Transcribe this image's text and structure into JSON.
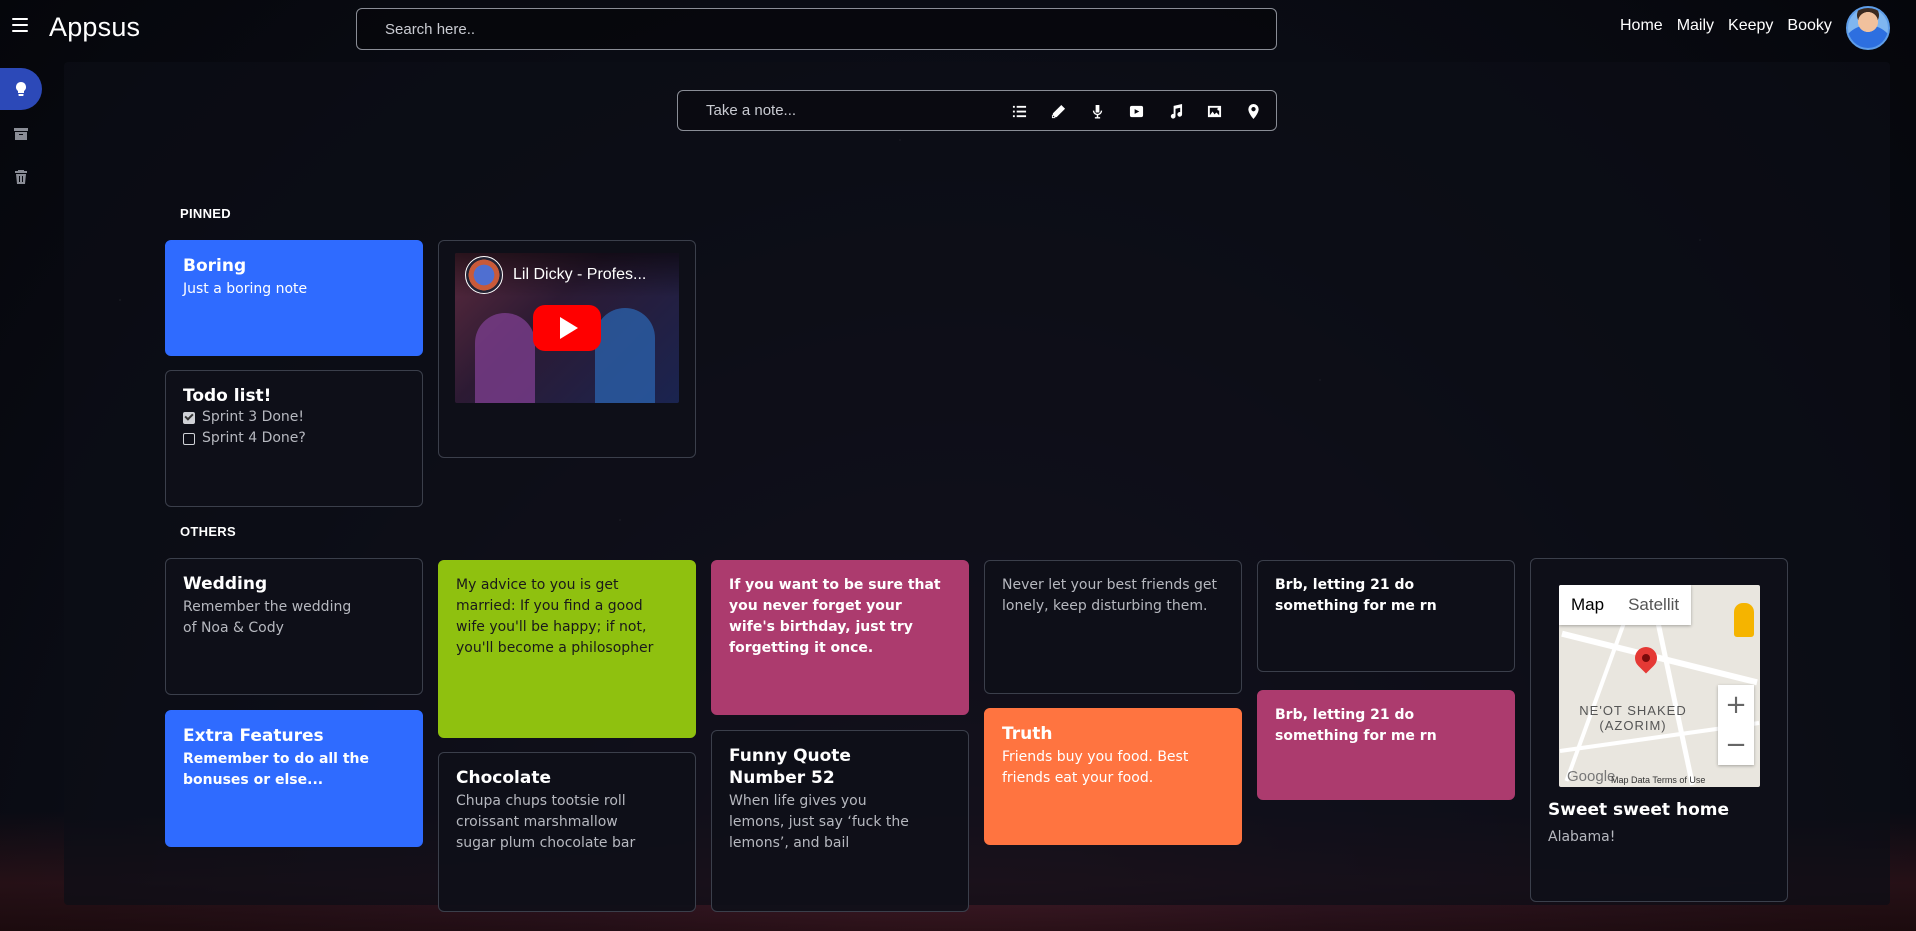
{
  "app": {
    "title": "Appsus"
  },
  "header": {
    "search_placeholder": "Search here..",
    "nav": [
      "Home",
      "Maily",
      "Keepy",
      "Booky"
    ]
  },
  "sidebar": {
    "items": [
      {
        "name": "notes",
        "icon": "lightbulb-icon",
        "active": true
      },
      {
        "name": "archive",
        "icon": "archive-icon",
        "active": false
      },
      {
        "name": "trash",
        "icon": "trash-icon",
        "active": false
      }
    ]
  },
  "composer": {
    "placeholder": "Take a note...",
    "tools": [
      "list-icon",
      "pencil-icon",
      "microphone-icon",
      "youtube-icon",
      "music-icon",
      "image-icon",
      "location-pin-icon"
    ]
  },
  "sections": {
    "pinned": "PINNED",
    "others": "OTHERS"
  },
  "colors": {
    "blue": "#2f6bff",
    "green": "#8fc10f",
    "magenta": "#ac3b6e",
    "orange": "#ff7440",
    "accent": "#2c49b8"
  },
  "pinned": {
    "boring": {
      "title": "Boring",
      "body": "Just a boring note"
    },
    "todo": {
      "title": "Todo list!",
      "items": [
        {
          "text": "Sprint 3 Done!",
          "done": true
        },
        {
          "text": "Sprint 4 Done?",
          "done": false
        }
      ]
    },
    "video": {
      "title": "Lil Dicky - Profes..."
    }
  },
  "others": {
    "wedding": {
      "title": "Wedding",
      "body": "Remember the wedding of Noa & Cody"
    },
    "extra": {
      "title": "Extra Features",
      "body": "Remember to do all the bonuses or else..."
    },
    "advice": {
      "body": "My advice to you is get married: If you find a good wife you'll be happy; if not, you'll become a philosopher"
    },
    "chocolate": {
      "title": "Chocolate",
      "body": "Chupa chups tootsie roll croissant marshmallow sugar plum chocolate bar"
    },
    "birthday": {
      "body": "If you want to be sure that you never forget your wife's birthday, just try forgetting it once."
    },
    "funny": {
      "title": "Funny Quote Number 52",
      "body": "When life gives you lemons, just say ‘fuck the lemons’, and bail"
    },
    "friends": {
      "body": "Never let your best friends get lonely, keep disturbing them."
    },
    "truth": {
      "title": "Truth",
      "body": "Friends buy you food. Best friends eat your food."
    },
    "brb1": {
      "body": "Brb, letting 21 do something for me rn"
    },
    "brb2": {
      "body": "Brb, letting 21 do something for me rn"
    },
    "home": {
      "title": "Sweet sweet home",
      "body": "Alabama!",
      "map": {
        "tab_map": "Map",
        "tab_sat": "Satellit",
        "place": "NE'OT SHAKED (AZORIM)",
        "attribution": "Map Data   Terms of Use",
        "google": "Google",
        "zoom_in": "+",
        "zoom_out": "−"
      }
    }
  }
}
